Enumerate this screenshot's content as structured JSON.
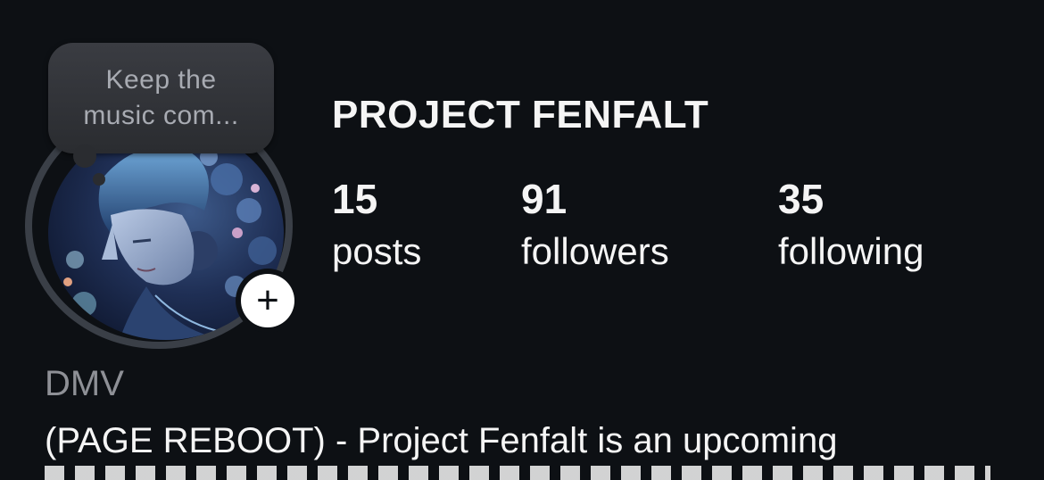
{
  "profile": {
    "note": "Keep the\nmusic com...",
    "username": "PROJECT FENFALT",
    "add_icon": "plus-icon",
    "stats": [
      {
        "count": "15",
        "label": "posts"
      },
      {
        "count": "91",
        "label": "followers"
      },
      {
        "count": "35",
        "label": "following"
      }
    ],
    "category": "DMV",
    "bio": "(PAGE REBOOT) - Project Fenfalt is an upcoming"
  },
  "colors": {
    "background": "#0d1014",
    "text": "#f5f5f5",
    "muted": "#8e9096",
    "note_bg": "#2a2c30"
  }
}
